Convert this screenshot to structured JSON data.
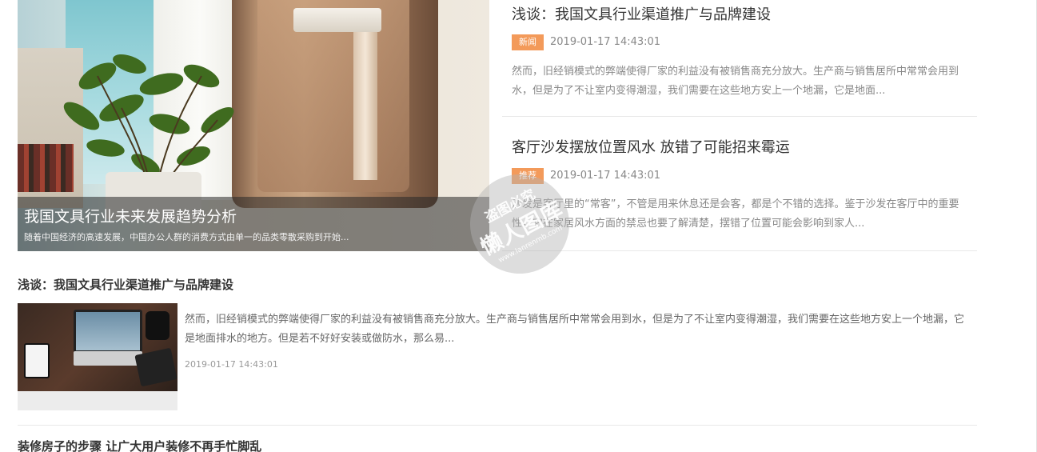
{
  "featured": {
    "title": "我国文具行业未来发展趋势分析",
    "desc": "随着中国经济的高速发展，中国办公人群的消费方式由单一的品类零散采购到开始..."
  },
  "news": [
    {
      "title": "浅谈：我国文具行业渠道推广与品牌建设",
      "tag": "新闻",
      "tag_color": "#f39a5a",
      "date": "2019-01-17 14:43:01",
      "desc": "然而，旧经销模式的弊端使得厂家的利益没有被销售商充分放大。生产商与销售居所中常常会用到水，但是为了不让室内变得潮湿，我们需要在这些地方安上一个地漏，它是地面..."
    },
    {
      "title": "客厅沙发摆放位置风水 放错了可能招来霉运",
      "tag": "推荐",
      "tag_color": "#f39a5a",
      "date": "2019-01-17 14:43:01",
      "desc": "沙发是客厅里的“常客”，不管是用来休息还是会客，都是个不错的选择。鉴于沙发在客厅中的重要性，它在家居风水方面的禁忌也要了解清楚，摆错了位置可能会影响到家人..."
    }
  ],
  "article": {
    "title": "浅谈：我国文具行业渠道推广与品牌建设",
    "desc": "然而，旧经销模式的弊端使得厂家的利益没有被销售商充分放大。生产商与销售居所中常常会用到水，但是为了不让室内变得潮湿，我们需要在这些地方安上一个地漏，它是地面排水的地方。但是若不好好安装或做防水，那么易...",
    "date": "2019-01-17 14:43:01"
  },
  "article2": {
    "title": "装修房子的步骤 让广大用户装修不再手忙脚乱"
  },
  "watermark": {
    "line1": "盗图必究",
    "line2": "懒人图库",
    "line3": "www.lanrenmb.com"
  }
}
